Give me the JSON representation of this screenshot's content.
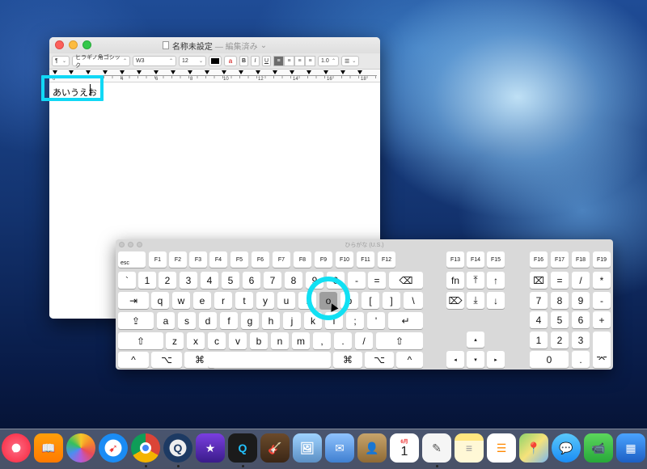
{
  "textedit": {
    "title": "名称未設定",
    "title_suffix": "— 編集済み",
    "toolbar": {
      "paragraph_style": "¶",
      "font_family": "ヒラギノ角ゴシック",
      "font_weight": "W3",
      "font_size": "12",
      "bold": "B",
      "italic": "I",
      "underline": "U",
      "line_spacing": "1.0"
    },
    "ruler_numbers": [
      "4",
      "6",
      "8",
      "10",
      "12",
      "14",
      "16",
      "18"
    ],
    "ruler_zero": "0",
    "text_plain": "あいうえ",
    "text_marked": "お"
  },
  "keyboard_viewer": {
    "title": "ひらがな (U.S.)",
    "keys": {
      "esc": "esc",
      "function": [
        "F1",
        "F2",
        "F3",
        "F4",
        "F5",
        "F6",
        "F7",
        "F8",
        "F9",
        "F10",
        "F11",
        "F12"
      ],
      "function_mid": [
        "F13",
        "F14",
        "F15"
      ],
      "function_right": [
        "F16",
        "F17",
        "F18",
        "F19"
      ],
      "row_numbers": [
        "`",
        "1",
        "2",
        "3",
        "4",
        "5",
        "6",
        "7",
        "8",
        "9",
        "0",
        "-",
        "=",
        "⌫"
      ],
      "row_q": [
        "⇥",
        "q",
        "w",
        "e",
        "r",
        "t",
        "y",
        "u",
        "i",
        "o",
        "p",
        "[",
        "]",
        "\\"
      ],
      "row_a": [
        "⇪",
        "a",
        "s",
        "d",
        "f",
        "g",
        "h",
        "j",
        "k",
        "l",
        ";",
        "'",
        "↵"
      ],
      "row_z": [
        "⇧",
        "z",
        "x",
        "c",
        "v",
        "b",
        "n",
        "m",
        ",",
        ".",
        "/",
        "⇧"
      ],
      "row_bottom": [
        "^",
        "⌥",
        "⌘",
        "⌘",
        "⌥",
        "^"
      ],
      "nav": [
        "fn",
        "⤒",
        "↑",
        "⌦",
        "⤓",
        "↓"
      ],
      "arrows": [
        "▴",
        "◂",
        "▾",
        "▸"
      ],
      "numpad_row1": [
        "⌧",
        "=",
        "/",
        "*"
      ],
      "numpad_row2": [
        "7",
        "8",
        "9",
        "-"
      ],
      "numpad_row3": [
        "4",
        "5",
        "6",
        "+"
      ],
      "numpad_row4": [
        "1",
        "2",
        "3"
      ],
      "numpad_row5": [
        "0",
        "."
      ],
      "numpad_enter": "⌤"
    },
    "pressed_key": "o"
  },
  "dock": {
    "items": [
      "music-icon",
      "books-icon",
      "photos-icon",
      "safari-icon",
      "chrome-icon",
      "quicktime-icon",
      "imovie-icon",
      "q-app-icon",
      "garageband-icon",
      "preview-icon",
      "mail-icon",
      "contacts-icon",
      "calendar-icon",
      "textedit-icon",
      "notes-icon",
      "reminders-icon",
      "maps-icon",
      "messages-icon",
      "facetime-icon",
      "keynote-icon"
    ],
    "calendar_month": "6月",
    "calendar_day": "1"
  },
  "colors": {
    "highlight": "#11d8f5",
    "pressed_key": "#9e9e9e"
  }
}
